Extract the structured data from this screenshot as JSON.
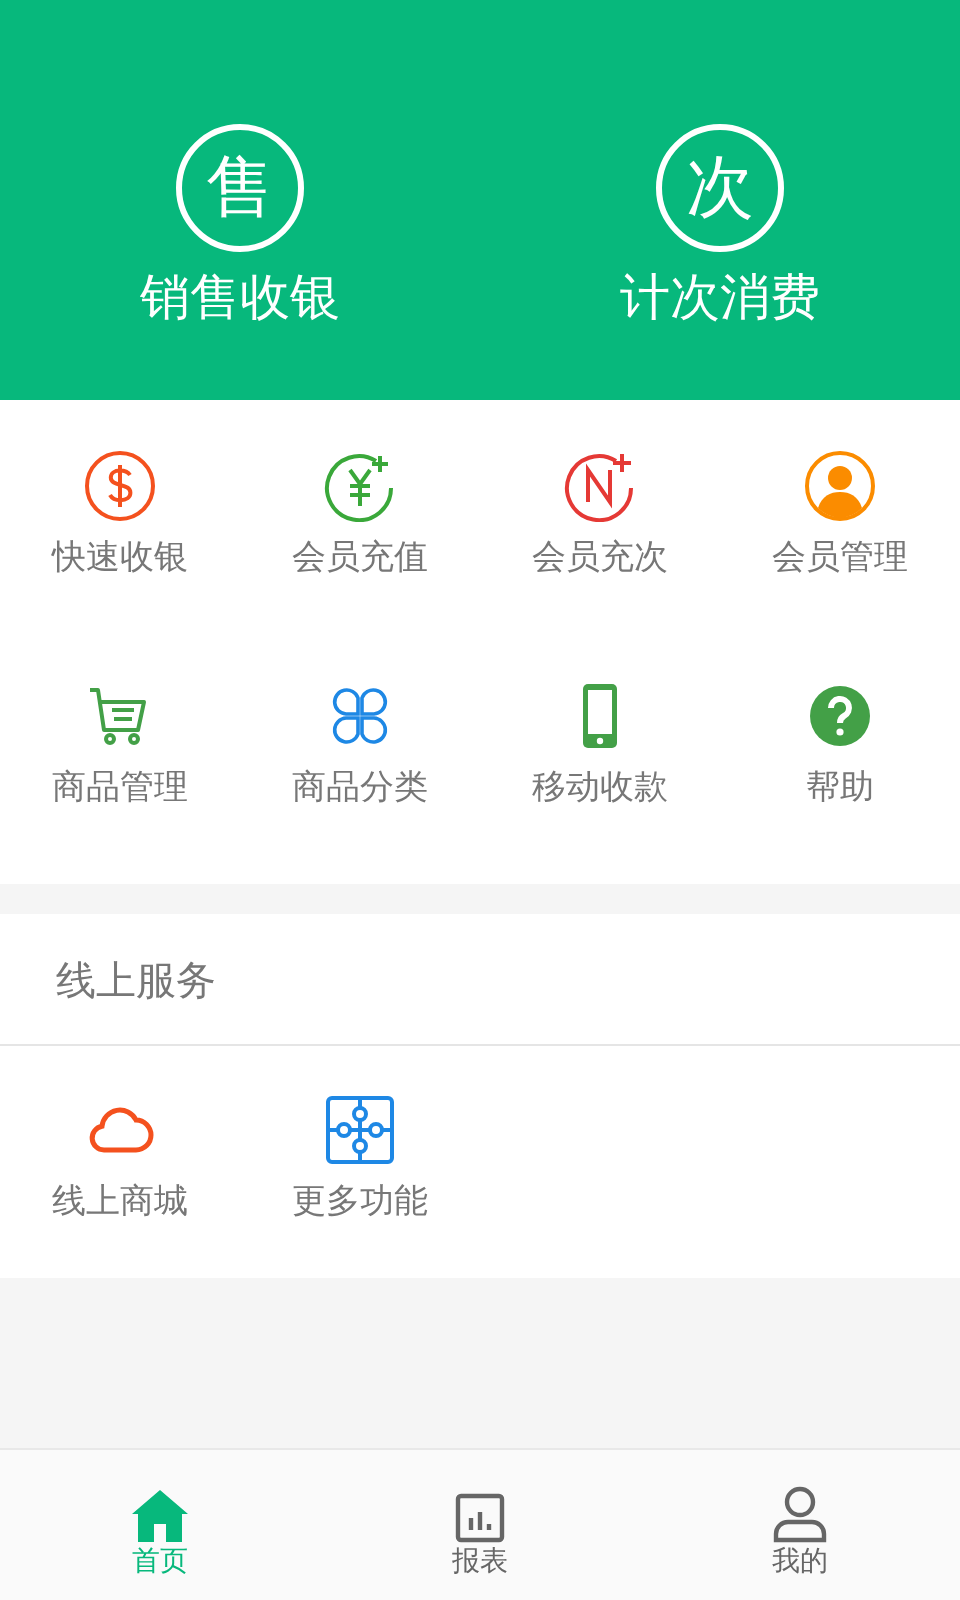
{
  "header_actions": [
    {
      "glyph": "售",
      "label": "销售收银"
    },
    {
      "glyph": "次",
      "label": "计次消费"
    }
  ],
  "grid": [
    {
      "label": "快速收银"
    },
    {
      "label": "会员充值"
    },
    {
      "label": "会员充次"
    },
    {
      "label": "会员管理"
    },
    {
      "label": "商品管理"
    },
    {
      "label": "商品分类"
    },
    {
      "label": "移动收款"
    },
    {
      "label": "帮助"
    }
  ],
  "online_section": {
    "title": "线上服务",
    "items": [
      {
        "label": "线上商城"
      },
      {
        "label": "更多功能"
      }
    ]
  },
  "tabs": [
    {
      "label": "首页",
      "selected": true
    },
    {
      "label": "报表",
      "selected": false
    },
    {
      "label": "我的",
      "selected": false
    }
  ]
}
